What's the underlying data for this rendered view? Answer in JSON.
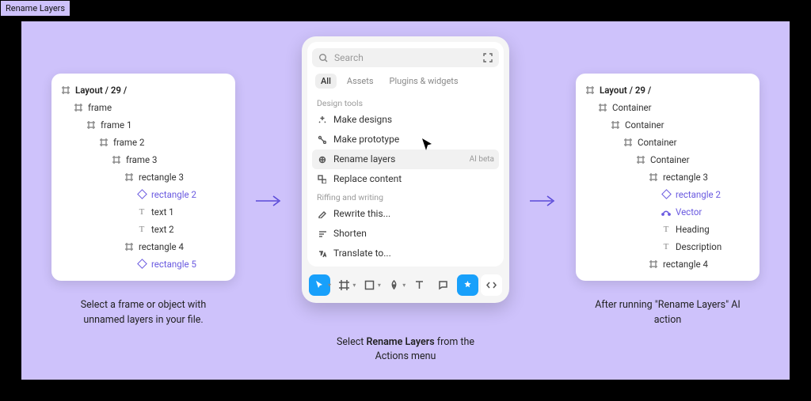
{
  "topTag": "Rename Layers",
  "left": {
    "header": "Layout / 29 /",
    "items": [
      {
        "icon": "frame",
        "label": "frame",
        "indent": 1,
        "sel": false
      },
      {
        "icon": "frame",
        "label": "frame 1",
        "indent": 2,
        "sel": false
      },
      {
        "icon": "frame",
        "label": "frame 2",
        "indent": 3,
        "sel": false
      },
      {
        "icon": "frame",
        "label": "frame 3",
        "indent": 4,
        "sel": false
      },
      {
        "icon": "frame",
        "label": "rectangle 3",
        "indent": 5,
        "sel": false
      },
      {
        "icon": "diamond",
        "label": "rectangle 2",
        "indent": 6,
        "sel": true
      },
      {
        "icon": "text",
        "label": "text 1",
        "indent": 6,
        "sel": false
      },
      {
        "icon": "text",
        "label": "text 2",
        "indent": 6,
        "sel": false
      },
      {
        "icon": "frame",
        "label": "rectangle 4",
        "indent": 5,
        "sel": false
      },
      {
        "icon": "diamond",
        "label": "rectangle 5",
        "indent": 6,
        "sel": true
      }
    ],
    "caption": "Select a frame or object with\nunnamed layers in your file."
  },
  "middle": {
    "searchPlaceholder": "Search",
    "tabs": {
      "all": "All",
      "assets": "Assets",
      "plugins": "Plugins & widgets"
    },
    "section1": "Design tools",
    "actions1": [
      {
        "icon": "sparkle",
        "label": "Make designs"
      },
      {
        "icon": "proto",
        "label": "Make prototype"
      },
      {
        "icon": "rename",
        "label": "Rename layers",
        "badge": "AI beta",
        "hov": true
      },
      {
        "icon": "replace",
        "label": "Replace content"
      }
    ],
    "section2": "Riffing and writing",
    "actions2": [
      {
        "icon": "rewrite",
        "label": "Rewrite this..."
      },
      {
        "icon": "shorten",
        "label": "Shorten"
      },
      {
        "icon": "translate",
        "label": "Translate to..."
      }
    ],
    "captionPrefix": "Select ",
    "captionBold": "Rename Layers",
    "captionSuffix": " from the\nActions menu"
  },
  "right": {
    "header": "Layout / 29 /",
    "items": [
      {
        "icon": "frame",
        "label": "Container",
        "indent": 1,
        "sel": false
      },
      {
        "icon": "frame",
        "label": "Container",
        "indent": 2,
        "sel": false
      },
      {
        "icon": "frame",
        "label": "Container",
        "indent": 3,
        "sel": false
      },
      {
        "icon": "frame",
        "label": "Container",
        "indent": 4,
        "sel": false
      },
      {
        "icon": "frame",
        "label": "rectangle 3",
        "indent": 5,
        "sel": false
      },
      {
        "icon": "diamond",
        "label": "rectangle 2",
        "indent": 6,
        "sel": true
      },
      {
        "icon": "vector",
        "label": "Vector",
        "indent": 6,
        "sel": true
      },
      {
        "icon": "text",
        "label": "Heading",
        "indent": 6,
        "sel": false
      },
      {
        "icon": "text",
        "label": "Description",
        "indent": 6,
        "sel": false
      },
      {
        "icon": "frame",
        "label": "rectangle 4",
        "indent": 5,
        "sel": false
      }
    ],
    "caption": "After running \"Rename Layers\" AI\naction"
  }
}
